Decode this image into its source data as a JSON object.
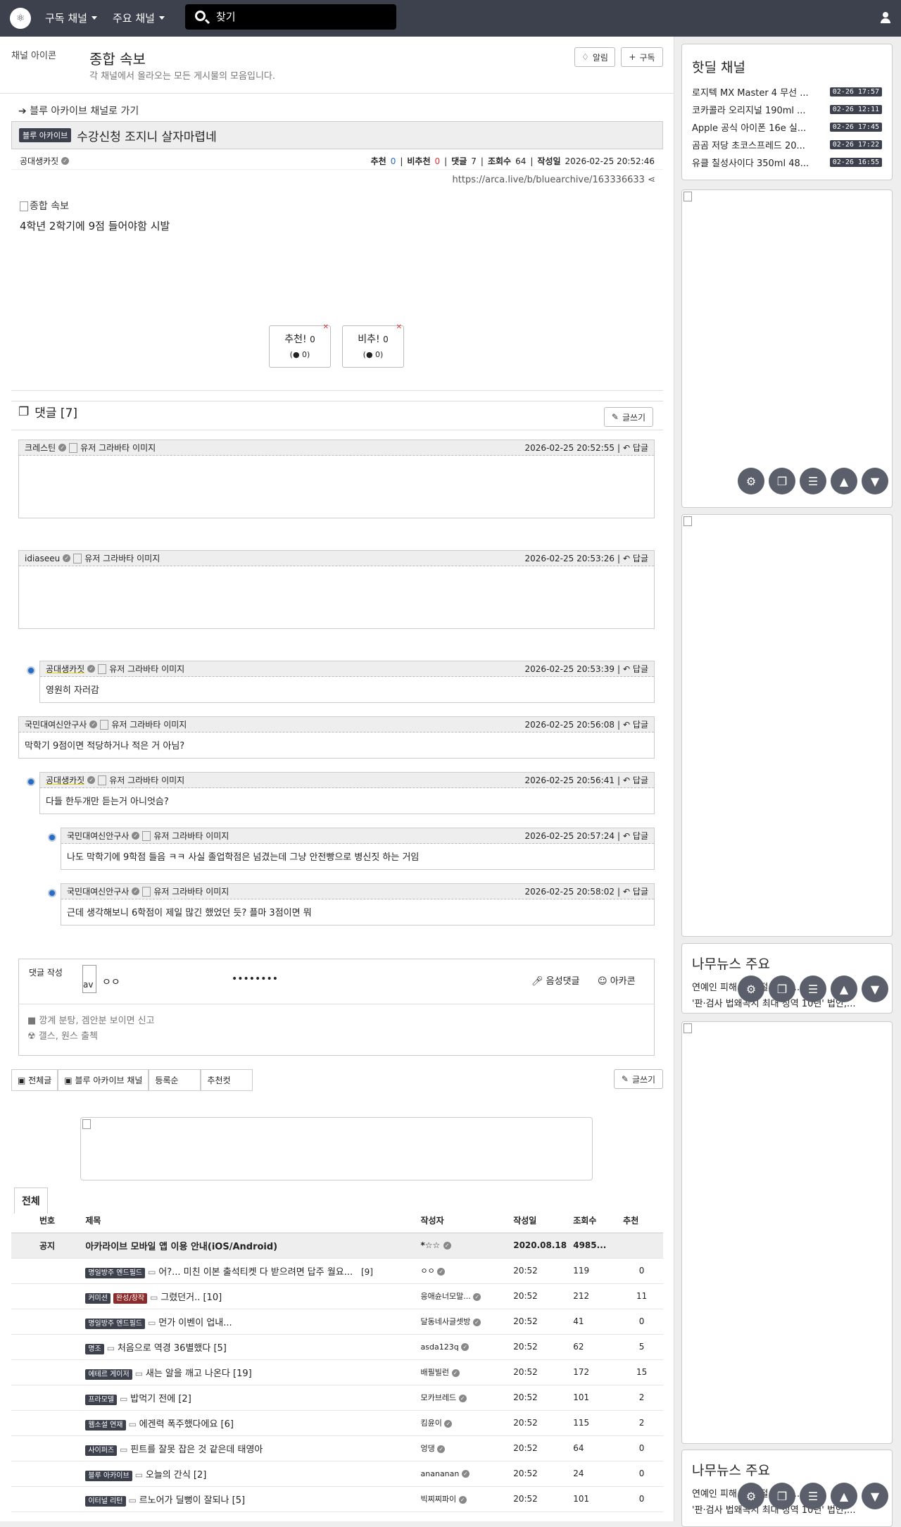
{
  "nav": {
    "subscribed": "구독 채널",
    "major": "주요 채널",
    "search_placeholder": "찾기"
  },
  "channel": {
    "icon_alt": "채널 아이콘",
    "title": "종합 속보",
    "desc": "각 채널에서 올라오는 모든 게시물의 모음입니다.",
    "alert": "알림",
    "subscribe": "구독"
  },
  "post": {
    "back": "블루 아카이브 채널로 가기",
    "badge": "블루 아카이브",
    "title": "수강신청 조지니 살자마렵네",
    "author": "공대생카짓",
    "rec_label": "추천",
    "rec": "0",
    "nrec_label": "비추천",
    "nrec": "0",
    "cm_label": "댓글",
    "cm": "7",
    "view_label": "조회수",
    "view": "64",
    "date_label": "작성일",
    "date": "2026-02-25 20:52:46",
    "url": "https://arca.live/b/bluearchive/163336633",
    "img_alt": "종합 속보",
    "body": "4학년 2학기에 9점 들어야함 시발",
    "up": "추천!",
    "up_count": "0",
    "up_sub": "0",
    "down": "비추!",
    "down_count": "0",
    "down_sub": "0"
  },
  "comments": {
    "header": "댓글 [7]",
    "write": "글쓰기",
    "reply": "답글",
    "avatar_alt": "유저 그라바타 이미지",
    "items": [
      {
        "author": "크레스틴",
        "date": "2026-02-25 20:52:55",
        "text": ""
      },
      {
        "author": "idiaseeu",
        "date": "2026-02-25 20:53:26",
        "text": ""
      },
      {
        "author": "공대생카짓",
        "date": "2026-02-25 20:53:39",
        "text": "영원히 자러감"
      },
      {
        "author": "국민대여신안구사",
        "date": "2026-02-25 20:56:08",
        "text": "막학기 9점이면 적당하거나 적은 거 아님?"
      },
      {
        "author": "공대생카짓",
        "date": "2026-02-25 20:56:41",
        "text": "다들 한두개만 듣는거 아니엇슴?"
      },
      {
        "author": "국민대여신안구사",
        "date": "2026-02-25 20:57:24",
        "text": "나도 막학기에 9학점 들음 ㅋㅋ 사실 졸업학점은 넘겼는데 그냥 안전빵으로 병신짓 하는 거임"
      },
      {
        "author": "국민대여신안구사",
        "date": "2026-02-25 20:58:02",
        "text": "근데 생각해보니 6학점이 제일 많긴 했었던 듯? 플마 3점이면 뭐"
      }
    ]
  },
  "write_box": {
    "label": "댓글 작성",
    "avatar": "av",
    "nick": "ㅇㅇ",
    "password": "••••••••",
    "voice": "음성댓글",
    "arcacon": "아카콘",
    "rule1": "■ 깡계 분탕, 겜안분 보이면 신고",
    "rule2": "☢ 갤스, 원스 출첵"
  },
  "list_tabs": {
    "all": "전체글",
    "channel": "블루 아카이브 채널",
    "order": "등록순",
    "best": "추천컷",
    "write": "글쓰기",
    "tab_all": "전체"
  },
  "table": {
    "headers": [
      "번호",
      "제목",
      "작성자",
      "작성일",
      "조회수",
      "추천"
    ],
    "notice": {
      "no": "공지",
      "title": "아카라이브 모바일 앱 이용 안내(iOS/Android)",
      "author": "*☆☆",
      "date": "2020.08.18",
      "views": "4985...",
      "rec": ""
    },
    "rows": [
      {
        "cat": "명일방주 엔드필드",
        "title": "어?... 미친 이본 출석티켓 다 받으려면 답주 월요...",
        "cmt": "[9]",
        "author": "ㅇㅇ",
        "date": "20:52",
        "views": "119",
        "rec": "0"
      },
      {
        "cat": "커미션",
        "cat2": "완성/창작",
        "title": "그렸던거.. [10]",
        "cmt": "",
        "author": "응애슌너모말...",
        "date": "20:52",
        "views": "212",
        "rec": "11"
      },
      {
        "cat": "명일방주 엔드필드",
        "title": "먼가 이벤이 업내...",
        "cmt": "",
        "author": "달동네사글셋방",
        "date": "20:52",
        "views": "41",
        "rec": "0"
      },
      {
        "cat": "명조",
        "title": "처음으로 역경 36별했다 [5]",
        "cmt": "",
        "author": "asda123q",
        "date": "20:52",
        "views": "62",
        "rec": "5"
      },
      {
        "cat": "에테르 게이저",
        "title": "새는 알을 깨고 나온다 [19]",
        "cmt": "",
        "author": "배필빌런",
        "date": "20:52",
        "views": "172",
        "rec": "15"
      },
      {
        "cat": "프라모델",
        "title": "밥먹기 전에 [2]",
        "cmt": "",
        "author": "모카브레드",
        "date": "20:52",
        "views": "101",
        "rec": "2"
      },
      {
        "cat": "웹소설 연재",
        "title": "에겐력 폭주했다에요 [6]",
        "cmt": "",
        "author": "킴윤이",
        "date": "20:52",
        "views": "115",
        "rec": "2"
      },
      {
        "cat": "사이퍼즈",
        "title": "핀트를 잘못 잡은 것 같은데 태영아",
        "cmt": "",
        "author": "엉댕",
        "date": "20:52",
        "views": "64",
        "rec": "0"
      },
      {
        "cat": "블루 아카이브",
        "title": "오늘의 간식 [2]",
        "cmt": "",
        "author": "anananan",
        "date": "20:52",
        "views": "24",
        "rec": "0"
      },
      {
        "cat": "이터널 리턴",
        "title": "르노어가 딜뻥이 잘되나 [5]",
        "cmt": "",
        "author": "빅찌찌파이",
        "date": "20:52",
        "views": "101",
        "rec": "0"
      }
    ]
  },
  "sidebar": {
    "hot_title": "핫딜 채널",
    "hot": [
      {
        "t": "로지텍 MX Master 4 무선 ...",
        "d": "02-26 17:57"
      },
      {
        "t": "코카콜라 오리지널 190ml ...",
        "d": "02-26 12:11"
      },
      {
        "t": "Apple 공식 아이폰 16e 실...",
        "d": "02-26 17:45"
      },
      {
        "t": "곰곰 저당 초코스프레드 20...",
        "d": "02-26 17:22"
      },
      {
        "t": "유클 칠성사이다 350ml 48...",
        "d": "02-26 16:55"
      }
    ],
    "news_title": "나무뉴스 주요",
    "news": [
      "연예인 피해 ... 근절 방지 ...",
      "'판·검사 법왜곡시 최대 징역 10년' 법안,..."
    ]
  }
}
